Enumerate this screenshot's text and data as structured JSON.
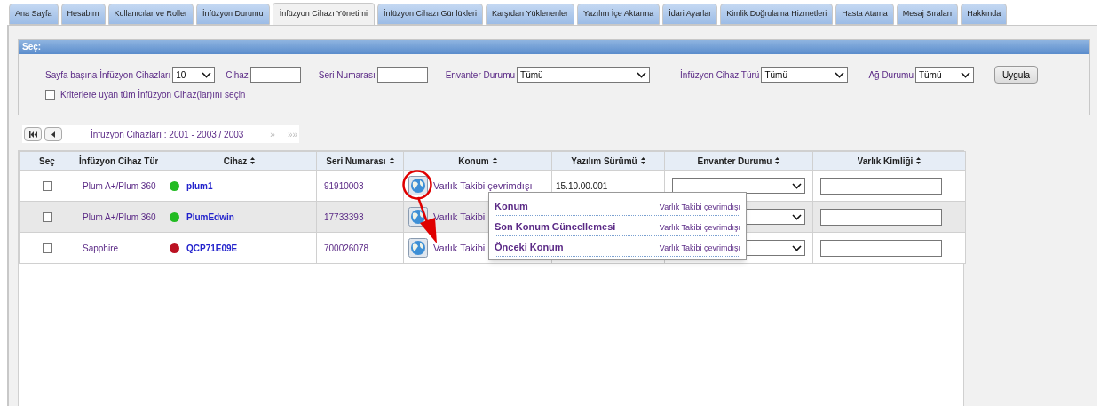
{
  "tabs": [
    {
      "label": "Ana Sayfa",
      "selected": false
    },
    {
      "label": "Hesabım",
      "selected": false
    },
    {
      "label": "Kullanıcılar ve Roller",
      "selected": false
    },
    {
      "label": "İnfüzyon Durumu",
      "selected": false
    },
    {
      "label": "İnfüzyon Cihazı Yönetimi",
      "selected": true
    },
    {
      "label": "İnfüzyon Cihazı Günlükleri",
      "selected": false
    },
    {
      "label": "Karşıdan Yüklenenler",
      "selected": false
    },
    {
      "label": "Yazılım İçe Aktarma",
      "selected": false
    },
    {
      "label": "İdari Ayarlar",
      "selected": false
    },
    {
      "label": "Kimlik Doğrulama Hizmetleri",
      "selected": false
    },
    {
      "label": "Hasta Atama",
      "selected": false
    },
    {
      "label": "Mesaj Sıraları",
      "selected": false
    },
    {
      "label": "Hakkında",
      "selected": false
    }
  ],
  "filter": {
    "title": "Seç:",
    "fields": [
      {
        "kind": "select",
        "label": "Sayfa başına İnfüzyon Cihazları",
        "value": "10"
      },
      {
        "kind": "text",
        "label": "Cihaz"
      },
      {
        "kind": "text",
        "label": "Seri Numarası"
      },
      {
        "kind": "select",
        "label": "Envanter Durumu",
        "value": "Tümü"
      },
      {
        "kind": "select",
        "label": "İnfüzyon Cihaz Türü",
        "value": "Tümü"
      },
      {
        "kind": "select",
        "label": "Ağ Durumu",
        "value": "Tümü"
      }
    ],
    "apply_button": "Uygula",
    "select_all": {
      "label": "Kriterlere uyan tüm İnfüzyon Cihaz(lar)ını seçin",
      "checked": false
    }
  },
  "pagination": {
    "summary": "İnfüzyon Cihazları : 2001 - 2003 / 2003",
    "next": "»",
    "last": "»»",
    "next_disabled": true
  },
  "table": {
    "columns": [
      {
        "label": "Seç",
        "sortable": false
      },
      {
        "label": "İnfüzyon Cihaz Tür",
        "sortable": false
      },
      {
        "label": "Cihaz",
        "sortable": true
      },
      {
        "label": "Seri Numarası",
        "sortable": true
      },
      {
        "label": "Konum",
        "sortable": true
      },
      {
        "label": "Yazılım Sürümü",
        "sortable": true
      },
      {
        "label": "Envanter Durumu",
        "sortable": true
      },
      {
        "label": "Varlık Kimliği",
        "sortable": true
      }
    ],
    "rows": [
      {
        "checked": false,
        "highlighted": false,
        "type": "Plum A+/Plum 360",
        "color": "#22bb22",
        "device": "plum1",
        "serial": "91910003",
        "location": "Varlık Takibi çevrimdışı",
        "software": "15.10.00.001"
      },
      {
        "checked": false,
        "highlighted": true,
        "type": "Plum A+/Plum 360",
        "color": "#22bb22",
        "device": "PlumEdwin",
        "serial": "17733393",
        "location": "Varlık Takibi"
      },
      {
        "checked": false,
        "highlighted": false,
        "type": "Sapphire",
        "color": "#bb1122",
        "device": "QCP71E09E",
        "serial": "700026078",
        "location": "Varlık Takibi"
      }
    ]
  },
  "location_popup": {
    "items": [
      {
        "label": "Konum",
        "value": "Varlık Takibi çevrimdışı"
      },
      {
        "label": "Son Konum Güncellemesi",
        "value": "Varlık Takibi çevrimdışı"
      },
      {
        "label": "Önceki Konum",
        "value": "Varlık Takibi çevrimdışı"
      }
    ]
  }
}
